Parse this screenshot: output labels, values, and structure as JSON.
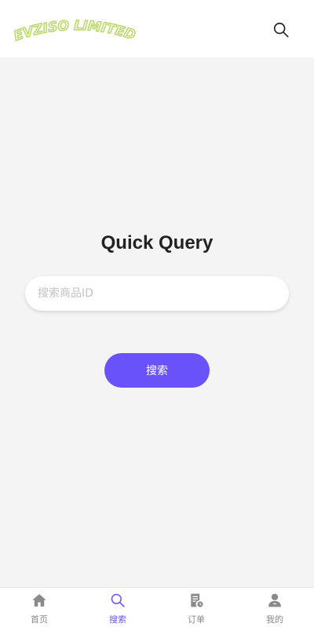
{
  "header": {
    "logo_text": "EVZISO LIMITED",
    "logo_color": "#c8e08a",
    "search_icon": "search-icon"
  },
  "main": {
    "title": "Quick Query",
    "search_placeholder": "搜索商品ID",
    "search_value": "",
    "submit_label": "搜索",
    "accent_color": "#6a52fb"
  },
  "bottom_nav": {
    "items": [
      {
        "label": "首页",
        "icon": "home-icon",
        "active": false
      },
      {
        "label": "搜索",
        "icon": "search-icon",
        "active": true
      },
      {
        "label": "订单",
        "icon": "order-icon",
        "active": false
      },
      {
        "label": "我的",
        "icon": "user-icon",
        "active": false
      }
    ]
  }
}
